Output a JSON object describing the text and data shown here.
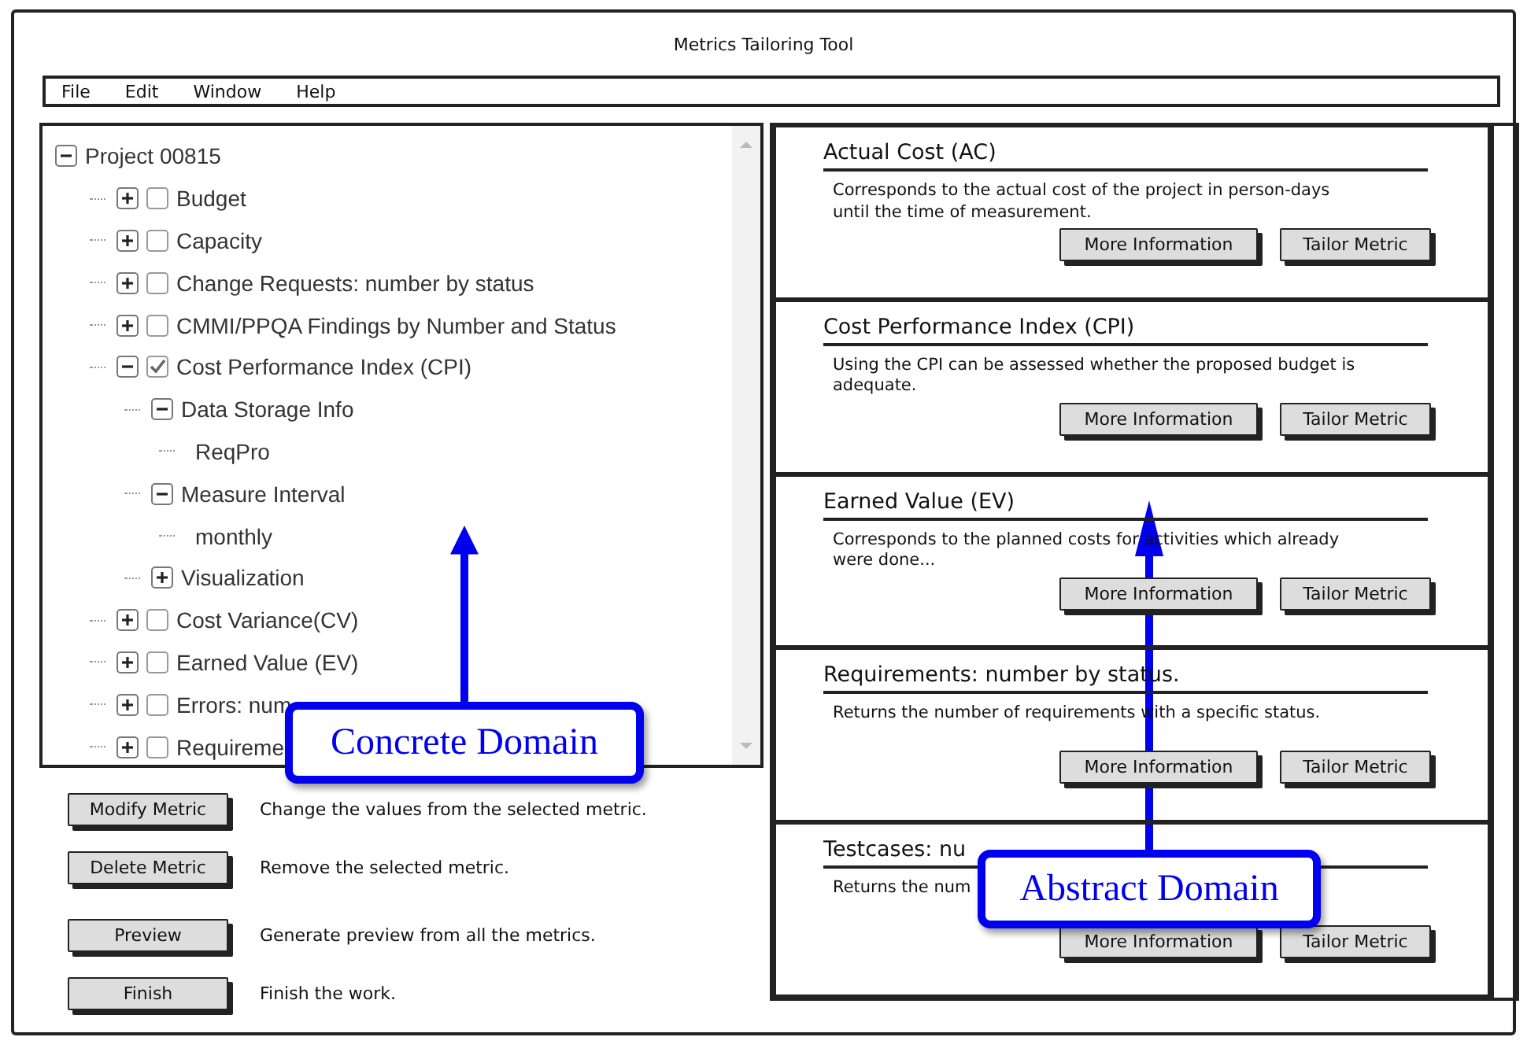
{
  "window": {
    "title": "Metrics Tailoring Tool"
  },
  "menu": [
    "File",
    "Edit",
    "Window",
    "Help"
  ],
  "tree": [
    {
      "label": "Project 00815",
      "kind": "project",
      "expanded": true,
      "children": [
        {
          "label": "Budget",
          "kind": "metric",
          "expanded": false,
          "checked": false
        },
        {
          "label": "Capacity",
          "kind": "metric",
          "expanded": false,
          "checked": false
        },
        {
          "label": "Change Requests: number by status",
          "kind": "metric",
          "expanded": false,
          "checked": false
        },
        {
          "label": "CMMI/PPQA Findings by Number and Status",
          "kind": "metric",
          "expanded": false,
          "checked": false
        },
        {
          "label": "Cost Performance Index (CPI)",
          "kind": "metric",
          "expanded": true,
          "checked": true,
          "children": [
            {
              "label": "Data Storage Info",
              "kind": "setting",
              "expanded": true,
              "children": [
                {
                  "label": "ReqPro",
                  "kind": "value"
                }
              ]
            },
            {
              "label": "Measure Interval",
              "kind": "setting",
              "expanded": true,
              "children": [
                {
                  "label": "monthly",
                  "kind": "value"
                }
              ]
            },
            {
              "label": "Visualization",
              "kind": "setting",
              "expanded": false
            }
          ]
        },
        {
          "label": "Cost Variance(CV)",
          "kind": "metric",
          "expanded": false,
          "checked": false
        },
        {
          "label": "Earned Value (EV)",
          "kind": "metric",
          "expanded": false,
          "checked": false
        },
        {
          "label": "Errors: num",
          "kind": "metric",
          "expanded": false,
          "checked": false
        },
        {
          "label": "Requireme",
          "kind": "metric",
          "expanded": false,
          "checked": false
        }
      ]
    }
  ],
  "actions": [
    {
      "button": "Modify Metric",
      "description": "Change the values from the selected metric."
    },
    {
      "button": "Delete Metric",
      "description": "Remove the selected metric."
    },
    {
      "button": "Preview",
      "description": "Generate preview from all the metrics."
    },
    {
      "button": "Finish",
      "description": "Finish the work."
    }
  ],
  "cards": [
    {
      "title": "Actual Cost (AC)",
      "description": "Corresponds to the actual cost of the project in person-days until the time of measurement.",
      "buttons": [
        "More Information",
        "Tailor Metric"
      ]
    },
    {
      "title": "Cost Performance Index (CPI)",
      "description": "Using the CPI can be assessed whether the proposed budget is adequate.",
      "buttons": [
        "More Information",
        "Tailor Metric"
      ]
    },
    {
      "title": "Earned Value (EV)",
      "description": "Corresponds to the planned costs for activities which already were done...",
      "buttons": [
        "More Information",
        "Tailor Metric"
      ]
    },
    {
      "title": "Requirements: number by status.",
      "description": "Returns the number of requirements with a specific status.",
      "buttons": [
        "More Information",
        "Tailor Metric"
      ]
    },
    {
      "title": "Testcases: nu",
      "description": "Returns the num",
      "buttons": [
        "More Information",
        "Tailor Metric"
      ]
    }
  ],
  "callouts": [
    {
      "text": "Concrete Domain"
    },
    {
      "text": "Abstract Domain"
    }
  ]
}
